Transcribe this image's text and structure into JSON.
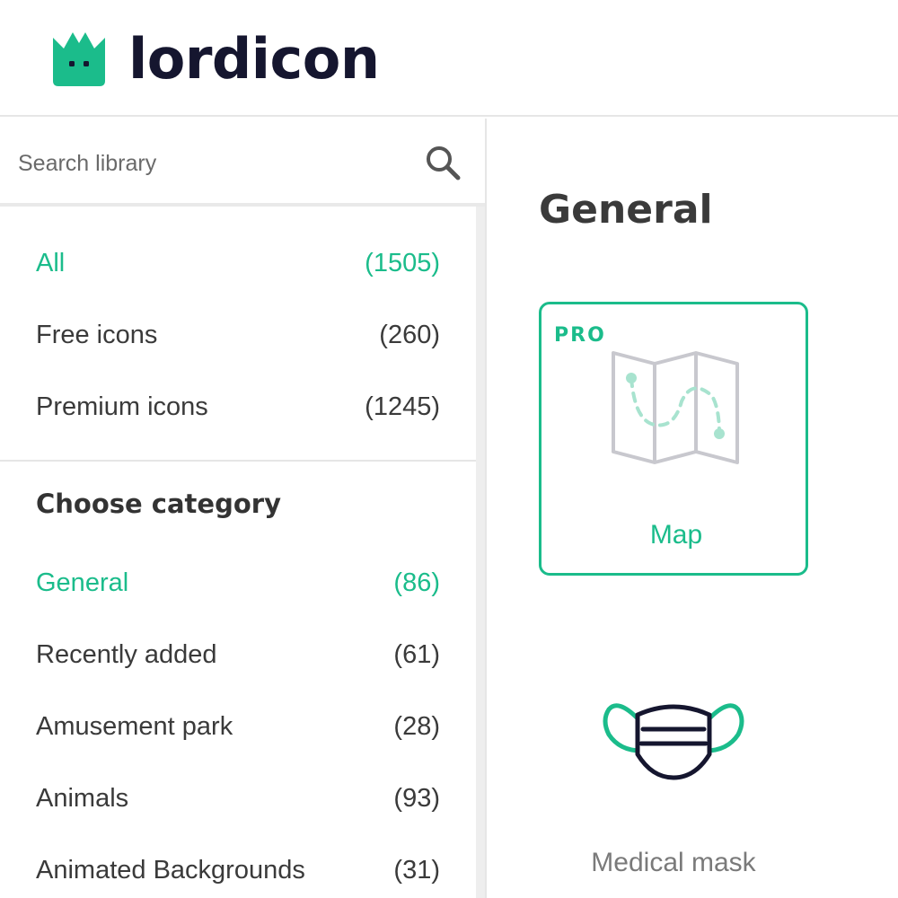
{
  "brand": {
    "name": "lordicon",
    "accent_color": "#1bbc8b",
    "dark_color": "#15162f"
  },
  "search": {
    "placeholder": "Search library",
    "value": ""
  },
  "filters": [
    {
      "label": "All",
      "count": "(1505)",
      "active": true
    },
    {
      "label": "Free icons",
      "count": "(260)",
      "active": false
    },
    {
      "label": "Premium icons",
      "count": "(1245)",
      "active": false
    }
  ],
  "categories": {
    "title": "Choose category",
    "items": [
      {
        "label": "General",
        "count": "(86)",
        "active": true
      },
      {
        "label": "Recently added",
        "count": "(61)",
        "active": false
      },
      {
        "label": "Amusement park",
        "count": "(28)",
        "active": false
      },
      {
        "label": "Animals",
        "count": "(93)",
        "active": false
      },
      {
        "label": "Animated Backgrounds",
        "count": "(31)",
        "active": false
      }
    ]
  },
  "main": {
    "title": "General",
    "icons": [
      {
        "label": "Map",
        "badge": "PRO",
        "icon": "map-icon",
        "selected": true
      },
      {
        "label": "Medical mask",
        "badge": "",
        "icon": "medical-mask-icon",
        "selected": false
      }
    ]
  }
}
